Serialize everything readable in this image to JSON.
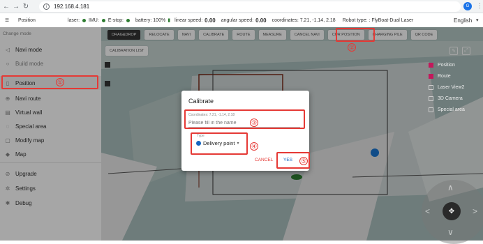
{
  "browser": {
    "url": "192.168.4.181",
    "profile": "G"
  },
  "appbar": {
    "title": "Position",
    "laser_label": "laser:",
    "imu_label": "IMU:",
    "estop_label": "E-stop:",
    "battery": "battery: 100%",
    "linear_label": "linear speed:",
    "linear_value": "0.00",
    "angular_label": "angular speed:",
    "angular_value": "0.00",
    "coordinates": "coordinates: 7.21, -1.14, 2.18",
    "robot_type": "Robot type: : FlyBoat-Dual Laser",
    "language": "English"
  },
  "sidebar": {
    "header": "Change mode",
    "items": [
      {
        "label": "Navi mode",
        "icon": "navigation-icon"
      },
      {
        "label": "Build mode",
        "icon": "build-icon"
      },
      {
        "label": "Position",
        "icon": "position-icon"
      },
      {
        "label": "Navi route",
        "icon": "route-icon"
      },
      {
        "label": "Virtual wall",
        "icon": "wall-icon"
      },
      {
        "label": "Special area",
        "icon": "area-icon"
      },
      {
        "label": "Modify map",
        "icon": "edit-icon"
      },
      {
        "label": "Map",
        "icon": "map-icon"
      },
      {
        "label": "Upgrade",
        "icon": "upgrade-icon"
      },
      {
        "label": "Settings",
        "icon": "gear-icon"
      },
      {
        "label": "Debug",
        "icon": "bug-icon"
      }
    ]
  },
  "toolbar": {
    "buttons": [
      "DRAG&DROP",
      "RELOCATE",
      "NAVI",
      "CALIBRATE",
      "ROUTE",
      "MEASURE",
      "CANCEL NAVI",
      "CUR POSITION",
      "CHARGING PILE",
      "QR CODE"
    ],
    "calibration_list": "CALIBRATION LIST"
  },
  "layers": [
    "Position",
    "Route",
    "Laser View2",
    "3D Camera",
    "Special area"
  ],
  "dialog": {
    "title": "Calibrate",
    "coordinates": "Coordinates:  7.21, -1.14, 2.18",
    "name_placeholder": "Please fill in the name",
    "type_label": "Type",
    "type_value": "Delivery point",
    "cancel": "CANCEL",
    "yes": "YES"
  },
  "markers": {
    "n1": "①",
    "n2": "②",
    "n3": "③",
    "n4": "④",
    "n5": "⑤"
  },
  "colors": {
    "highlight": "#e53935",
    "accent": "#1565c0",
    "status_ok": "#2e7d32"
  }
}
